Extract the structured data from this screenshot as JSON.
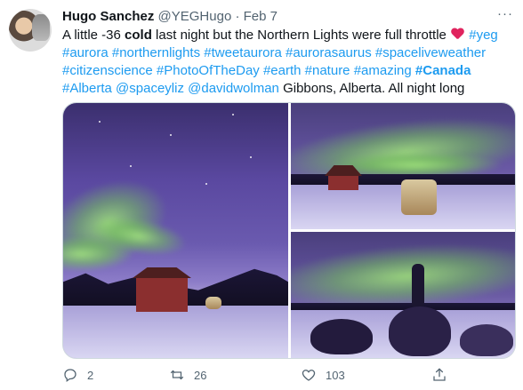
{
  "tweet": {
    "author": {
      "name": "Hugo Sanchez",
      "handle": "@YEGHugo",
      "separator": "·",
      "date": "Feb 7"
    },
    "more_label": "···",
    "text": {
      "part1": "A little -36 ",
      "cold": "cold",
      "part2": " last night but the Northern Lights were full throttle ",
      "tags1": "#yeg",
      "tags2": "#aurora #northernlights #tweetaurora #aurorasaurus #spaceliveweather",
      "tags3": "#citizenscience #PhotoOfTheDay #earth #nature #amazing",
      "canada": "#Canada",
      "tags4": "#Alberta @spaceyliz @davidwolman",
      "tail": " Gibbons, Alberta. All night long"
    },
    "actions": {
      "reply_count": "2",
      "retweet_count": "26",
      "like_count": "103"
    },
    "colors": {
      "link": "#1d9bf0",
      "heart": "#e0245e",
      "muted": "#536471"
    }
  }
}
